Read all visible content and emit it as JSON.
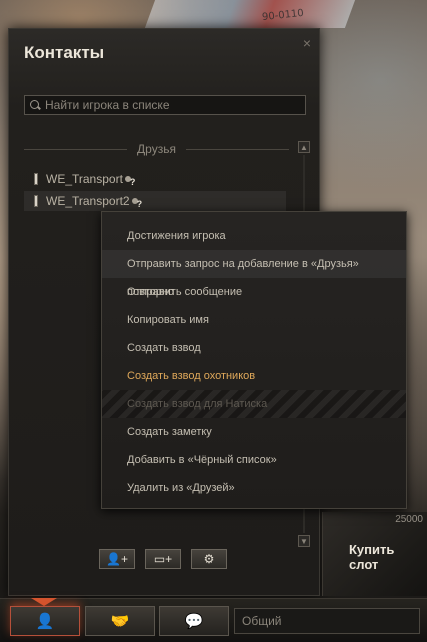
{
  "window": {
    "title": "Контакты",
    "close_glyph": "×"
  },
  "search": {
    "placeholder": "Найти игрока в списке"
  },
  "group": {
    "label": "Друзья"
  },
  "contacts": [
    {
      "name": "WE_Transport"
    },
    {
      "name": "WE_Transport2"
    }
  ],
  "context_menu": {
    "items": [
      {
        "label": "Достижения игрока"
      },
      {
        "label": "Отправить запрос на добавление в «Друзья» повторно"
      },
      {
        "label": "Отправить сообщение"
      },
      {
        "label": "Копировать имя"
      },
      {
        "label": "Создать взвод"
      },
      {
        "label": "Создать взвод охотников"
      },
      {
        "label": "Создать взвод для Натиска"
      },
      {
        "label": "Создать заметку"
      },
      {
        "label": "Добавить в «Чёрный список»"
      },
      {
        "label": "Удалить из «Друзей»"
      }
    ]
  },
  "slot": {
    "price": "25000",
    "label": "Купить слот"
  },
  "bottom_bar": {
    "channel_label": "Общий"
  },
  "background": {
    "boat_number": "90-0110"
  },
  "colors": {
    "accent": "#dfa85a",
    "active_marker": "#d4552f"
  },
  "icons": {
    "contacts": "user-icon",
    "clan": "handshake-icon",
    "chat": "chat-icon",
    "add_user": "add-user-icon",
    "add_group": "add-folder-icon",
    "settings": "gear-icon"
  }
}
